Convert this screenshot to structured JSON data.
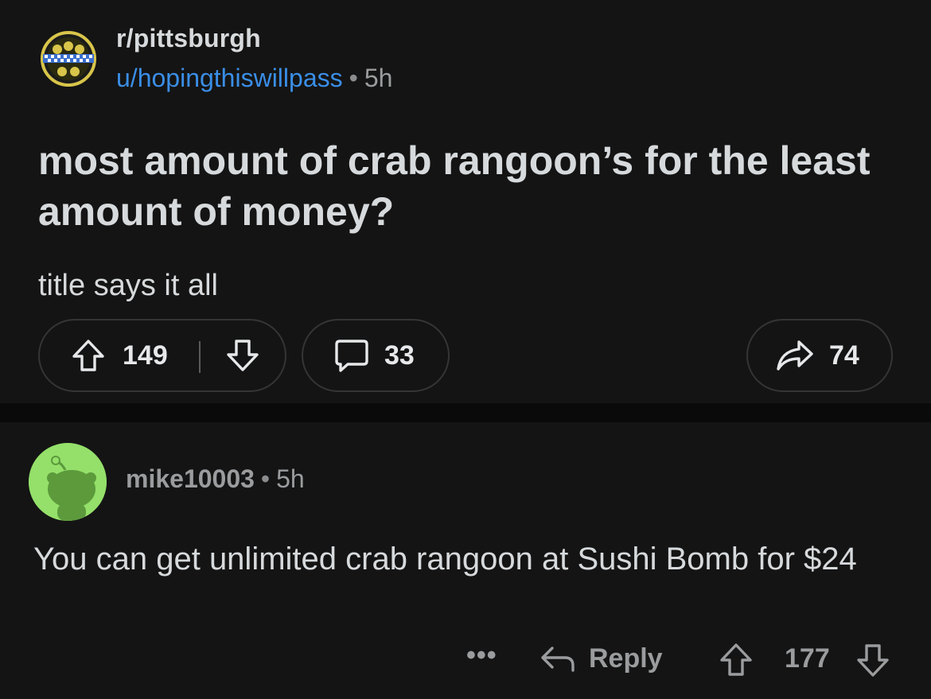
{
  "post": {
    "subreddit": "r/pittsburgh",
    "username": "u/hopingthiswillpass",
    "separator": "•",
    "age": "5h",
    "title": "most amount of crab rangoon’s for the least amount of money?",
    "body": "title says it all",
    "upvotes": "149",
    "comments": "33",
    "shares": "74"
  },
  "comment": {
    "username": "mike10003",
    "separator": "•",
    "age": "5h",
    "text": "You can get unlimited crab rangoon at Sushi Bomb for $24",
    "more_label": "•••",
    "reply_label": "Reply",
    "score": "177"
  },
  "colors": {
    "background": "#141414",
    "username_blue": "#3a8ee6",
    "avatar_green": "#94e06a",
    "seal_gold": "#d8c54a"
  },
  "icons": [
    "pittsburgh-seal-icon",
    "upvote-icon",
    "downvote-icon",
    "comment-bubble-icon",
    "share-icon",
    "snoo-avatar-icon",
    "reply-icon",
    "more-icon"
  ]
}
